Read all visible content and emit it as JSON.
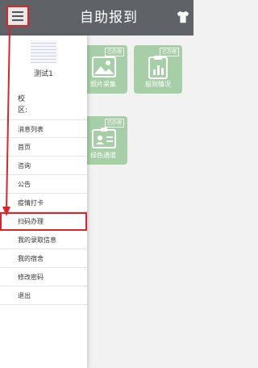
{
  "header": {
    "title": "自助报到",
    "menu_icon": "hamburger-icon",
    "right_icon": "shirt-icon"
  },
  "profile": {
    "name": "测试1",
    "school_label": "校",
    "district_label": "区:"
  },
  "menu": {
    "items": [
      {
        "label": "消息列表"
      },
      {
        "label": "首页"
      },
      {
        "label": "咨询"
      },
      {
        "label": "公告"
      },
      {
        "label": "疫情打卡"
      },
      {
        "label": "扫码办理",
        "highlighted": true
      },
      {
        "label": "我的录取信息"
      },
      {
        "label": "我的宿舍"
      },
      {
        "label": "修改密码"
      },
      {
        "label": "退出"
      }
    ]
  },
  "cards": [
    {
      "label": "照片采集",
      "badge": "已办理",
      "icon": "photo-icon"
    },
    {
      "label": "报到情况",
      "badge": "已办理",
      "icon": "clipboard-chart-icon"
    },
    {
      "label": "绿色通道",
      "badge": "已办理",
      "icon": "id-card-icon"
    }
  ],
  "colors": {
    "topbar": "#5f6368",
    "card_green": "#a7cfa7",
    "highlight_red": "#d9262a"
  }
}
